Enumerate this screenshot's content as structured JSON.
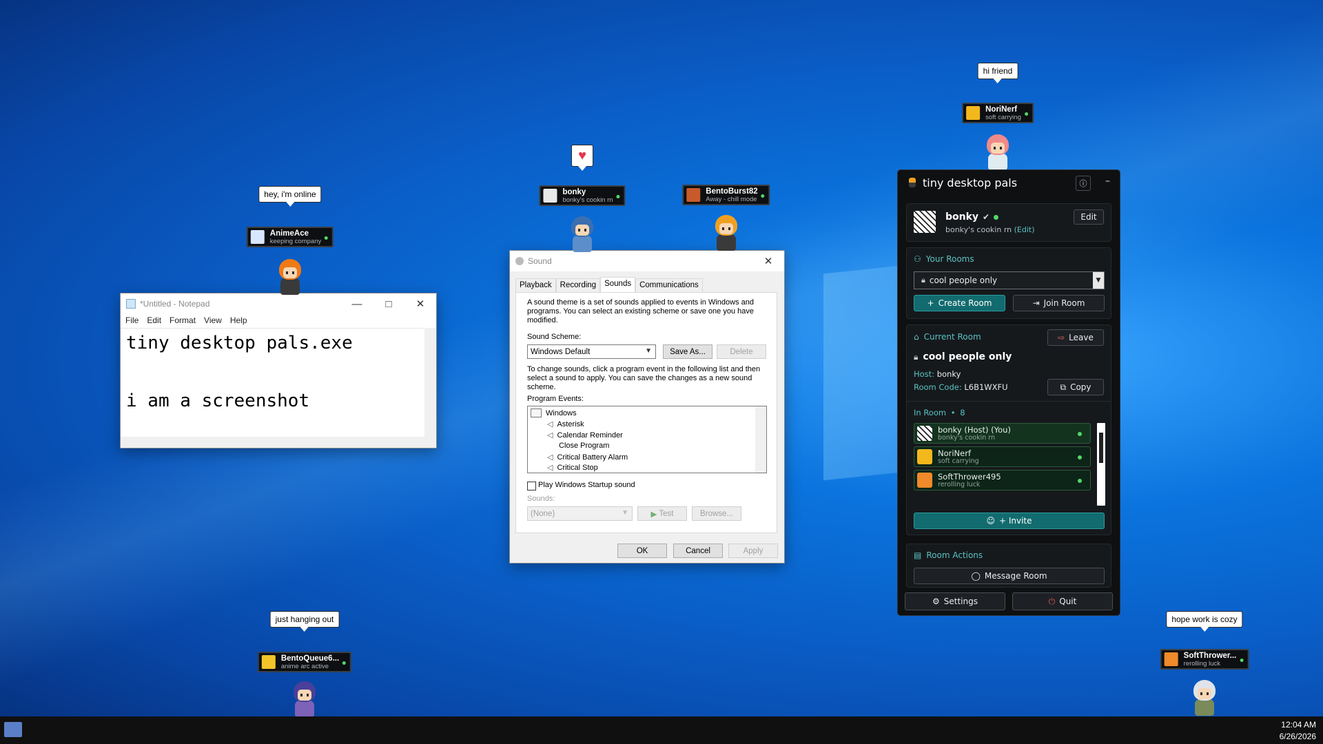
{
  "pals": [
    {
      "id": "animeace",
      "name": "AnimeAce",
      "status": "keeping company",
      "bubble": "hey, i'm online",
      "bubble_type": "text",
      "hair": "#f07a16",
      "body": "#3a3a3a",
      "avatar": "#d8e6ff"
    },
    {
      "id": "bonky",
      "name": "bonky",
      "status": "bonky's cookin rn",
      "bubble": "♥",
      "bubble_type": "heart",
      "hair": "#3b6fb0",
      "body": "#5c8fc9",
      "avatar": "#e9e9e9"
    },
    {
      "id": "bentoburst82",
      "name": "BentoBurst82",
      "status": "Away - chill mode",
      "bubble": "",
      "bubble_type": "none",
      "hair": "#f0a020",
      "body": "#3a3a3a",
      "avatar": "#c85a2a"
    },
    {
      "id": "norinerf",
      "name": "NoriNerf",
      "status": "soft carrying",
      "bubble": "hi friend",
      "bubble_type": "text",
      "hair": "#f08a8a",
      "body": "#e0ecf0",
      "avatar": "#f3b81c"
    },
    {
      "id": "bentoqueue",
      "name": "BentoQueue6...",
      "status": "anime arc active",
      "bubble": "just hanging out",
      "bubble_type": "text",
      "hair": "#4a3f9a",
      "body": "#7d62b8",
      "avatar": "#f3c42a"
    },
    {
      "id": "softthrower",
      "name": "SoftThrower...",
      "status": "rerolling luck",
      "bubble": "hope work is cozy",
      "bubble_type": "text",
      "hair": "#e0e4ea",
      "body": "#7a8a5a",
      "avatar": "#f08a2a"
    }
  ],
  "notepad": {
    "title": "*Untitled - Notepad",
    "menu": [
      "File",
      "Edit",
      "Format",
      "View",
      "Help"
    ],
    "lines": [
      "tiny desktop pals.exe",
      "",
      "i am a screenshot"
    ]
  },
  "sound": {
    "title": "Sound",
    "tabs": [
      "Playback",
      "Recording",
      "Sounds",
      "Communications"
    ],
    "active_tab": "Sounds",
    "intro": "A sound theme is a set of sounds applied to events in Windows and programs.  You can select an existing scheme or save one you have modified.",
    "scheme_label": "Sound Scheme:",
    "scheme_value": "Windows Default",
    "save_as": "Save As...",
    "delete": "Delete",
    "change_text": "To change sounds, click a program event in the following list and then select a sound to apply.  You can save the changes as a new sound scheme.",
    "events_label": "Program Events:",
    "events": [
      "Windows",
      "Asterisk",
      "Calendar Reminder",
      "Close Program",
      "Critical Battery Alarm",
      "Critical Stop"
    ],
    "startup_label": "Play Windows Startup sound",
    "sounds_label": "Sounds:",
    "sounds_value": "(None)",
    "test": "Test",
    "browse": "Browse...",
    "ok": "OK",
    "cancel": "Cancel",
    "apply": "Apply"
  },
  "panel": {
    "title": "tiny desktop pals",
    "user": {
      "name": "bonky",
      "status": "bonky's cookin rn",
      "edit_link": "(Edit)",
      "edit_button": "Edit"
    },
    "your_rooms": {
      "label": "Your Rooms",
      "selected": "cool people only",
      "create": "Create Room",
      "join": "Join Room"
    },
    "current_room": {
      "label": "Current Room",
      "leave": "Leave",
      "name": "cool people only",
      "host_label": "Host:",
      "host": "bonky",
      "code_label": "Room Code:",
      "code": "L6B1WXFU",
      "copy": "Copy"
    },
    "in_room": {
      "label": "In Room",
      "sep": "•",
      "count": "8"
    },
    "members": [
      {
        "name": "bonky (Host) (You)",
        "status": "bonky's cookin rn",
        "avatar": "#e9e9e9",
        "highlight": true
      },
      {
        "name": "NoriNerf",
        "status": "soft carrying",
        "avatar": "#f3b81c",
        "highlight": false
      },
      {
        "name": "SoftThrower495",
        "status": "rerolling luck",
        "avatar": "#f08a2a",
        "highlight": false
      }
    ],
    "invite": "+ Invite",
    "room_actions": {
      "label": "Room Actions",
      "message": "Message Room"
    },
    "settings": "Settings",
    "quit": "Quit"
  },
  "taskbar": {
    "time": "12:04 AM",
    "date": "6/26/2026"
  },
  "colors": {
    "accent_teal": "#126b6e",
    "online": "#53d769",
    "desktop": "#0a5fc8"
  }
}
